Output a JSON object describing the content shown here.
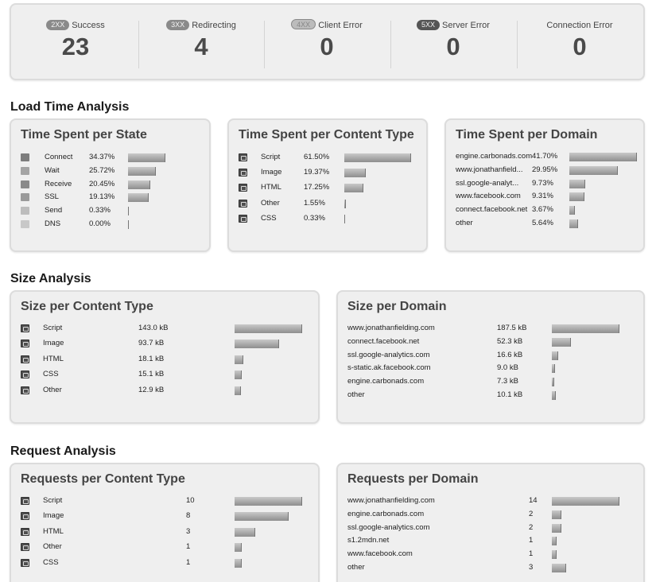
{
  "status": [
    {
      "badge": "2XX",
      "label": "Success",
      "count": "23"
    },
    {
      "badge": "3XX",
      "label": "Redirecting",
      "count": "4"
    },
    {
      "badge": "4XX",
      "label": "Client Error",
      "count": "0"
    },
    {
      "badge": "5XX",
      "label": "Server Error",
      "count": "0"
    },
    {
      "badge": "",
      "label": "Connection Error",
      "count": "0"
    }
  ],
  "sections": {
    "load": "Load Time Analysis",
    "size": "Size Analysis",
    "request": "Request Analysis"
  },
  "cards": {
    "time_state": {
      "title": "Time Spent per State",
      "rows": [
        {
          "label": "Connect",
          "value": "34.37%",
          "fraction": 0.3437,
          "icon": "state-connect-swatch"
        },
        {
          "label": "Wait",
          "value": "25.72%",
          "fraction": 0.2572,
          "icon": "state-wait-swatch"
        },
        {
          "label": "Receive",
          "value": "20.45%",
          "fraction": 0.2045,
          "icon": "state-receive-swatch"
        },
        {
          "label": "SSL",
          "value": "19.13%",
          "fraction": 0.1913,
          "icon": "state-ssl-swatch"
        },
        {
          "label": "Send",
          "value": "0.33%",
          "fraction": 0.0033,
          "icon": "state-send-swatch"
        },
        {
          "label": "DNS",
          "value": "0.00%",
          "fraction": 0.0,
          "icon": "state-dns-swatch"
        }
      ]
    },
    "time_type": {
      "title": "Time Spent per Content Type",
      "rows": [
        {
          "label": "Script",
          "value": "61.50%",
          "fraction": 0.615,
          "icon": "script-icon"
        },
        {
          "label": "Image",
          "value": "19.37%",
          "fraction": 0.1937,
          "icon": "image-icon"
        },
        {
          "label": "HTML",
          "value": "17.25%",
          "fraction": 0.1725,
          "icon": "html-icon"
        },
        {
          "label": "Other",
          "value": "1.55%",
          "fraction": 0.0155,
          "icon": "document-icon"
        },
        {
          "label": "CSS",
          "value": "0.33%",
          "fraction": 0.0033,
          "icon": "css-icon"
        }
      ]
    },
    "time_domain": {
      "title": "Time Spent per Domain",
      "rows": [
        {
          "label": "engine.carbonads.com",
          "value": "41.70%",
          "fraction": 0.417
        },
        {
          "label": "www.jonathanfield...",
          "value": "29.95%",
          "fraction": 0.2995
        },
        {
          "label": "ssl.google-analyt...",
          "value": "9.73%",
          "fraction": 0.0973
        },
        {
          "label": "www.facebook.com",
          "value": "9.31%",
          "fraction": 0.0931
        },
        {
          "label": "connect.facebook.net",
          "value": "3.67%",
          "fraction": 0.0367
        },
        {
          "label": "other",
          "value": "5.64%",
          "fraction": 0.0564
        }
      ]
    },
    "size_type": {
      "title": "Size per Content Type",
      "rows": [
        {
          "label": "Script",
          "value": "143.0 kB",
          "fraction": 1.0,
          "icon": "script-icon"
        },
        {
          "label": "Image",
          "value": "93.7 kB",
          "fraction": 0.655,
          "icon": "image-icon"
        },
        {
          "label": "HTML",
          "value": "18.1 kB",
          "fraction": 0.127,
          "icon": "html-icon"
        },
        {
          "label": "CSS",
          "value": "15.1 kB",
          "fraction": 0.106,
          "icon": "css-icon"
        },
        {
          "label": "Other",
          "value": "12.9 kB",
          "fraction": 0.09,
          "icon": "document-icon"
        }
      ]
    },
    "size_domain": {
      "title": "Size per Domain",
      "rows": [
        {
          "label": "www.jonathanfielding.com",
          "value": "187.5 kB",
          "fraction": 1.0
        },
        {
          "label": "connect.facebook.net",
          "value": "52.3 kB",
          "fraction": 0.279
        },
        {
          "label": "ssl.google-analytics.com",
          "value": "16.6 kB",
          "fraction": 0.0885
        },
        {
          "label": "s-static.ak.facebook.com",
          "value": "9.0 kB",
          "fraction": 0.048
        },
        {
          "label": "engine.carbonads.com",
          "value": "7.3 kB",
          "fraction": 0.039
        },
        {
          "label": "other",
          "value": "10.1 kB",
          "fraction": 0.054
        }
      ]
    },
    "req_type": {
      "title": "Requests per Content Type",
      "rows": [
        {
          "label": "Script",
          "value": "10",
          "fraction": 1.0,
          "icon": "script-icon"
        },
        {
          "label": "Image",
          "value": "8",
          "fraction": 0.8,
          "icon": "image-icon"
        },
        {
          "label": "HTML",
          "value": "3",
          "fraction": 0.3,
          "icon": "html-icon"
        },
        {
          "label": "Other",
          "value": "1",
          "fraction": 0.1,
          "icon": "document-icon"
        },
        {
          "label": "CSS",
          "value": "1",
          "fraction": 0.1,
          "icon": "css-icon"
        }
      ]
    },
    "req_domain": {
      "title": "Requests per Domain",
      "rows": [
        {
          "label": "www.jonathanfielding.com",
          "value": "14",
          "fraction": 1.0
        },
        {
          "label": "engine.carbonads.com",
          "value": "2",
          "fraction": 0.143
        },
        {
          "label": "ssl.google-analytics.com",
          "value": "2",
          "fraction": 0.143
        },
        {
          "label": "s1.2mdn.net",
          "value": "1",
          "fraction": 0.071
        },
        {
          "label": "www.facebook.com",
          "value": "1",
          "fraction": 0.071
        },
        {
          "label": "other",
          "value": "3",
          "fraction": 0.214
        }
      ]
    }
  }
}
